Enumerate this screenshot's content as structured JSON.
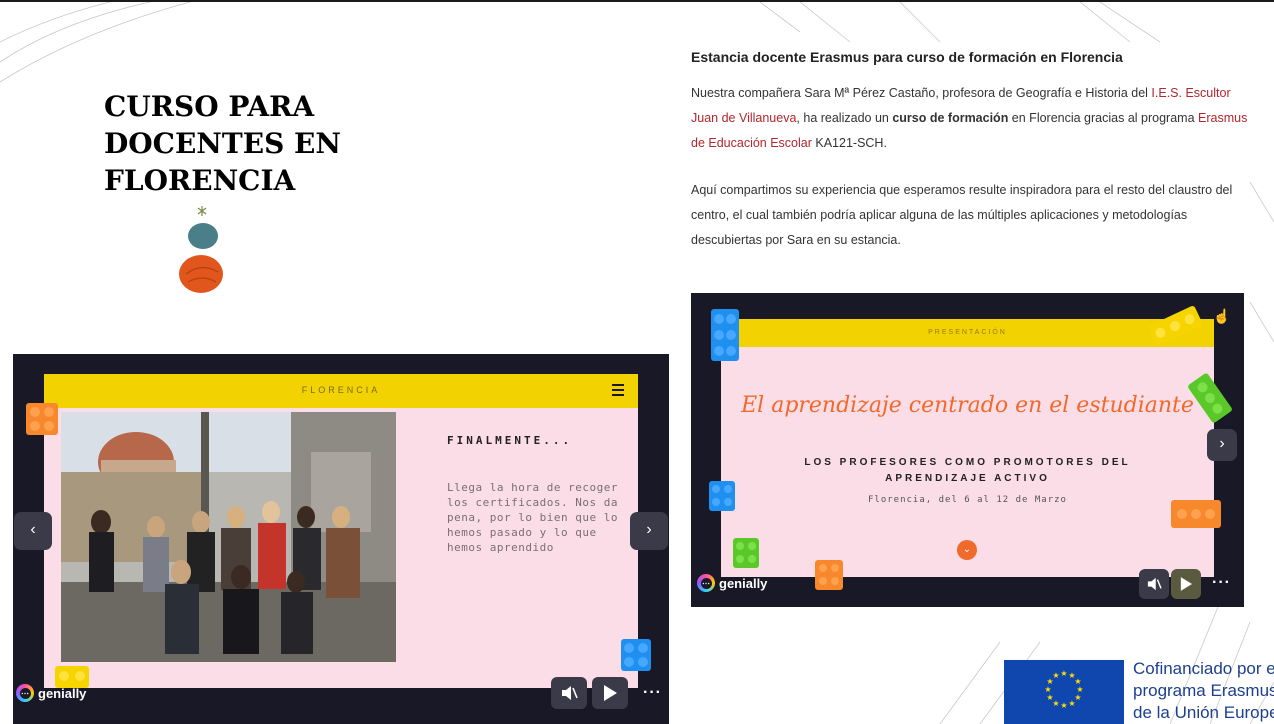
{
  "slide": {
    "title": "CURSO PARA\nDOCENTES EN\nFLORENCIA"
  },
  "left_embed": {
    "header_label": "FLORENCIA",
    "heading": "FINALMENTE...",
    "body": "Llega la hora de recoger los certificados. Nos da pena, por lo bien que lo hemos pasado y lo que hemos aprendido",
    "prev_label": "‹",
    "next_label": "›",
    "brand": "genially",
    "more_label": "···"
  },
  "article": {
    "title": "Estancia docente Erasmus para curso de formación en Florencia",
    "p1_a": "Nuestra compañera Sara Mª Pérez Castaño, profesora de Geografía e Historia del ",
    "p1_link1": "I.E.S. Escultor Juan de Villanueva",
    "p1_b": ", ha realizado un ",
    "p1_bold": "curso de formación",
    "p1_c": " en Florencia gracias al programa ",
    "p1_link2": "Erasmus de Educación Escolar",
    "p1_d": " KA121-SCH.",
    "p2": "Aquí compartimos su experiencia que esperamos resulte inspiradora para el resto del claustro del centro, el cual también podría aplicar alguna de las múltiples aplicaciones y metodologías descubiertas por Sara en su estancia."
  },
  "right_embed": {
    "header_label": "PRESENTACIÓN",
    "script_title": "El aprendizaje centrado en el estudiante",
    "subhead": "LOS PROFESORES COMO PROMOTORES DEL APRENDIZAJE ACTIVO",
    "date": "Florencia, del 6 al 12 de Marzo",
    "next_label": "›",
    "brand": "genially",
    "more_label": "···"
  },
  "eu_logo": {
    "line1": "Cofinanciado por el",
    "line2": "programa Erasmus+",
    "line3": "de la Unión Europea"
  },
  "colors": {
    "yellow": "#f2d200",
    "pink": "#fbdde8",
    "dark": "#181826",
    "orange": "#ef6a2b",
    "link": "#b2262c",
    "eu_blue": "#0f47af"
  },
  "icons": [
    "menu-icon",
    "mute-icon",
    "play-icon",
    "more-icon",
    "hand-pointer-icon",
    "chevron-down-icon"
  ]
}
